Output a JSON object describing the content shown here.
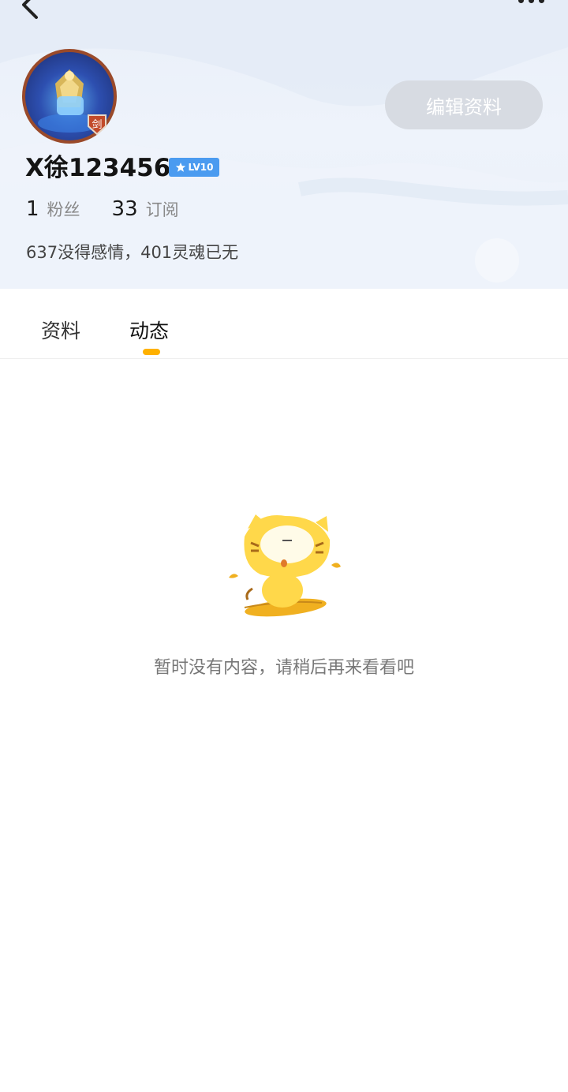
{
  "header": {
    "back_icon": "chevron-left-icon",
    "more_icon": "more-dots-icon",
    "edit_button_label": "编辑资料",
    "avatar_badge_text": "剑",
    "username": "X徐123456",
    "level_badge": "LV10",
    "fans_count": "1",
    "fans_label": "粉丝",
    "subscribe_count": "33",
    "subscribe_label": "订阅",
    "signature": "637没得感情，401灵魂已无"
  },
  "tabs": [
    {
      "label": "资料",
      "active": false
    },
    {
      "label": "动态",
      "active": true
    }
  ],
  "empty_state": {
    "illustration": "cat-mascot-on-leaf",
    "message": "暂时没有内容，请稍后再来看看吧"
  },
  "colors": {
    "accent": "#ffb100",
    "level_badge": "#4b9bf0",
    "edit_button_bg": "#d7dbe2",
    "header_bg": "#eaf0f9"
  }
}
